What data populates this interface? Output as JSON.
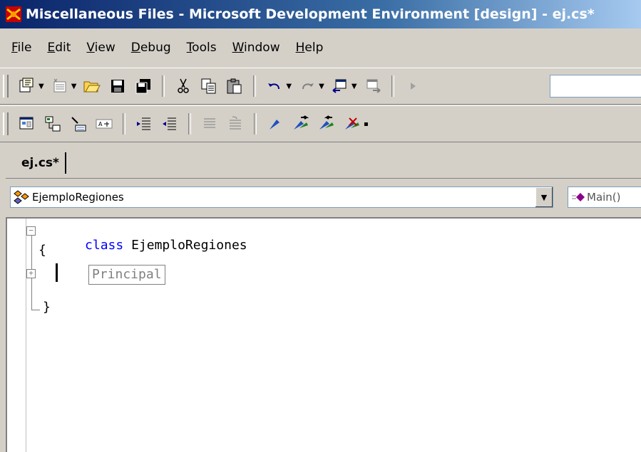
{
  "window": {
    "title": "Miscellaneous Files - Microsoft Development Environment [design] - ej.cs*"
  },
  "menu": {
    "items": [
      {
        "label": "File"
      },
      {
        "label": "Edit"
      },
      {
        "label": "View"
      },
      {
        "label": "Debug"
      },
      {
        "label": "Tools"
      },
      {
        "label": "Window"
      },
      {
        "label": "Help"
      }
    ]
  },
  "toolbar1": {
    "buttons": [
      {
        "icon": "new-project-icon"
      },
      {
        "icon": "add-item-icon"
      },
      {
        "icon": "open-folder-icon"
      },
      {
        "icon": "save-icon"
      },
      {
        "icon": "save-all-icon"
      },
      {
        "icon": "cut-icon"
      },
      {
        "icon": "copy-icon"
      },
      {
        "icon": "paste-icon"
      },
      {
        "icon": "undo-icon"
      },
      {
        "icon": "redo-icon"
      },
      {
        "icon": "navigate-backward-icon"
      },
      {
        "icon": "navigate-forward-icon"
      },
      {
        "icon": "start-icon"
      }
    ]
  },
  "toolbar2": {
    "buttons": [
      {
        "icon": "object-browser-icon"
      },
      {
        "icon": "class-view-icon"
      },
      {
        "icon": "task-list-icon"
      },
      {
        "icon": "word-wrap-icon"
      },
      {
        "icon": "indent-decrease-icon"
      },
      {
        "icon": "indent-increase-icon"
      },
      {
        "icon": "comment-icon"
      },
      {
        "icon": "uncomment-icon"
      },
      {
        "icon": "toggle-bookmark-icon"
      },
      {
        "icon": "next-bookmark-icon"
      },
      {
        "icon": "previous-bookmark-icon"
      },
      {
        "icon": "clear-bookmarks-icon"
      }
    ]
  },
  "tabs": [
    {
      "label": "ej.cs*"
    }
  ],
  "navigation": {
    "class_selector": "EjemploRegiones",
    "member_selector": "Main()"
  },
  "editor": {
    "keyword": "class",
    "class_name": "EjemploRegiones",
    "open_brace": "{",
    "region_label": "Principal",
    "close_brace": "}"
  },
  "colors": {
    "keyword": "#0000ff",
    "title_gradient_start": "#0a246a",
    "title_gradient_end": "#a6caf0"
  }
}
